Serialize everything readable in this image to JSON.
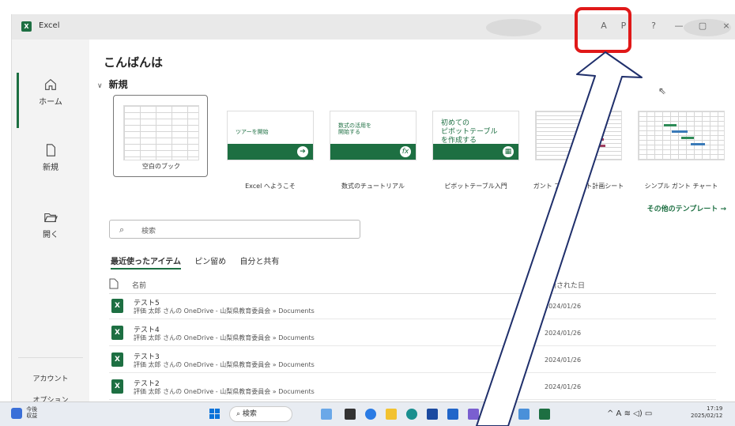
{
  "window": {
    "app_title": "Excel",
    "title_icons": [
      "A",
      "P",
      "?",
      "—",
      "▢",
      "×"
    ]
  },
  "sidebar": {
    "items": [
      {
        "label": "ホーム",
        "icon": "home-icon"
      },
      {
        "label": "新規",
        "icon": "new-file-icon"
      },
      {
        "label": "開く",
        "icon": "folder-open-icon"
      }
    ],
    "account": "アカウント",
    "options": "オプション"
  },
  "greeting": "こんばんは",
  "new_section": {
    "title": "新規"
  },
  "templates": [
    {
      "label": "空白のブック"
    },
    {
      "label": "Excel へようこそ",
      "thumb_text": "ツアーを開始"
    },
    {
      "label": "数式のチュートリアル",
      "thumb_text": "数式の活用を\n開始する"
    },
    {
      "label": "ピボットテーブル入門",
      "thumb_text": "初めての\nピボットテーブル\nを作成する"
    },
    {
      "label": "ガント プロジェクト計画シート"
    },
    {
      "label": "シンプル ガント チャート"
    }
  ],
  "more_templates": "その他のテンプレート →",
  "search": {
    "placeholder": "検索"
  },
  "tabs": [
    {
      "label": "最近使ったアイテム",
      "active": true
    },
    {
      "label": "ピン留め",
      "active": false
    },
    {
      "label": "自分と共有",
      "active": false
    }
  ],
  "list": {
    "header_name": "名前",
    "header_date": "更新された日",
    "rows": [
      {
        "title": "テスト5",
        "path": "評価 太郎 さんの OneDrive - 山梨県教育委員会 » Documents",
        "date": "2024/01/26"
      },
      {
        "title": "テスト4",
        "path": "評価 太郎 さんの OneDrive - 山梨県教育委員会 » Documents",
        "date": "2024/01/26"
      },
      {
        "title": "テスト3",
        "path": "評価 太郎 さんの OneDrive - 山梨県教育委員会 » Documents",
        "date": "2024/01/26"
      },
      {
        "title": "テスト2",
        "path": "評価 太郎 さんの OneDrive - 山梨県教育委員会 » Documents",
        "date": "2024/01/26"
      }
    ]
  },
  "taskbar": {
    "weather_line1": "今後",
    "weather_line2": "収益",
    "search_label": "検索",
    "tray": "^ A ≋ ◁) ▭",
    "time": "17:19",
    "date": "2025/02/12"
  },
  "colors": {
    "accent": "#1d6f42",
    "highlight": "#e01818"
  }
}
